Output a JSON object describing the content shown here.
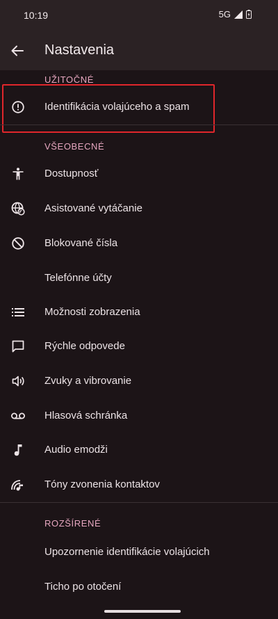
{
  "status": {
    "time": "10:19",
    "network": "5G"
  },
  "app_bar": {
    "title": "Nastavenia"
  },
  "sections": {
    "useful": {
      "header": "UŽITOČNÉ",
      "items": [
        {
          "label": "Identifikácia volajúceho a spam",
          "icon": "alert-circle-icon"
        }
      ]
    },
    "general": {
      "header": "VŠEOBECNÉ",
      "items": [
        {
          "label": "Dostupnosť",
          "icon": "accessibility-icon"
        },
        {
          "label": "Asistované vytáčanie",
          "icon": "assisted-dialing-icon"
        },
        {
          "label": "Blokované čísla",
          "icon": "block-icon"
        },
        {
          "label": "Telefónne účty",
          "icon": ""
        },
        {
          "label": "Možnosti zobrazenia",
          "icon": "list-icon"
        },
        {
          "label": "Rýchle odpovede",
          "icon": "message-icon"
        },
        {
          "label": "Zvuky a vibrovanie",
          "icon": "volume-icon"
        },
        {
          "label": "Hlasová schránka",
          "icon": "voicemail-icon"
        },
        {
          "label": "Audio emodži",
          "icon": "music-note-icon"
        },
        {
          "label": "Tóny zvonenia kontaktov",
          "icon": "contact-ringtone-icon"
        }
      ]
    },
    "advanced": {
      "header": "ROZŠÍRENÉ",
      "items": [
        {
          "label": "Upozornenie identifikácie volajúcich"
        },
        {
          "label": "Ticho po otočení"
        }
      ]
    }
  },
  "colors": {
    "background": "#1c1417",
    "app_bar": "#2b2224",
    "accent": "#e7a7c0",
    "highlight": "#e0262b"
  }
}
